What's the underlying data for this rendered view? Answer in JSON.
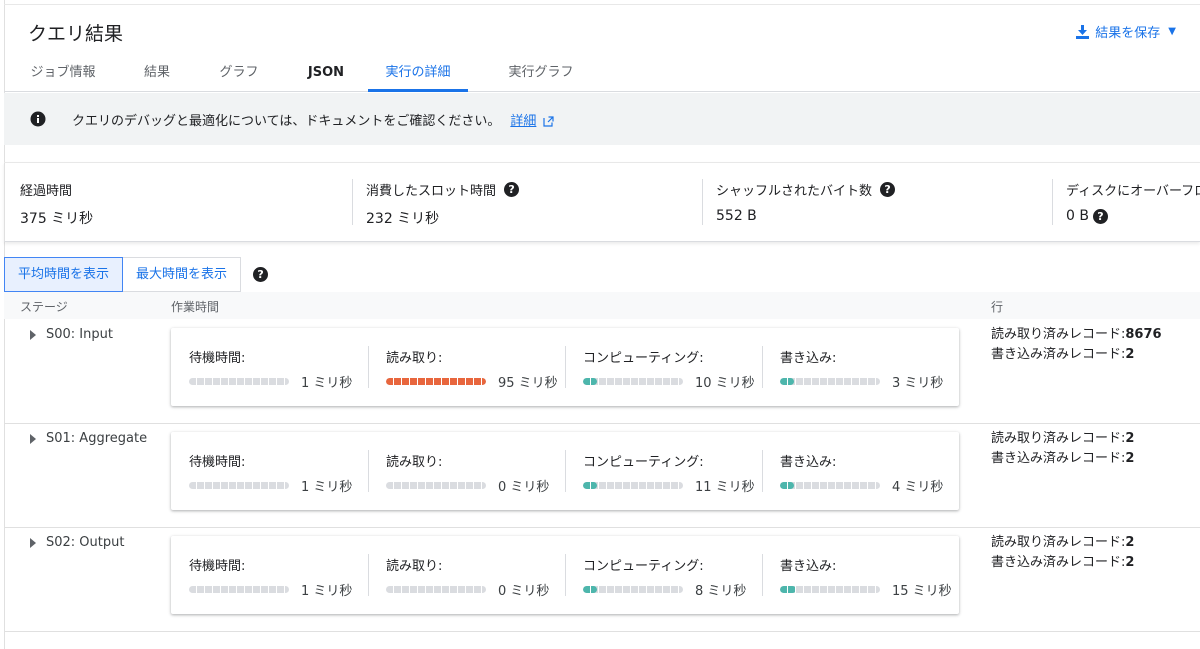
{
  "header": {
    "title": "クエリ結果",
    "save_label": "結果を保存"
  },
  "tabs": [
    {
      "label": "ジョブ情報"
    },
    {
      "label": "結果"
    },
    {
      "label": "グラフ"
    },
    {
      "label": "JSON"
    },
    {
      "label": "実行の詳細",
      "active": true
    },
    {
      "label": "実行グラフ"
    }
  ],
  "banner": {
    "text": "クエリのデバッグと最適化については、ドキュメントをご確認ください。",
    "link": "詳細"
  },
  "stats": [
    {
      "label": "経過時間",
      "value": "375 ミリ秒"
    },
    {
      "label": "消費したスロット時間",
      "value": "232 ミリ秒"
    },
    {
      "label": "シャッフルされたバイト数",
      "value": "552 B"
    },
    {
      "label": "ディスクにオーバーフロー",
      "value": "0 B"
    }
  ],
  "toggle": {
    "avg": "平均時間を表示",
    "max": "最大時間を表示"
  },
  "table_header": {
    "stage": "ステージ",
    "work": "作業時間",
    "rows": "行"
  },
  "segment_labels": {
    "wait": "待機時間:",
    "read": "読み取り:",
    "compute": "コンピューティング:",
    "write": "書き込み:"
  },
  "rows_labels": {
    "read": "読み取り済みレコード:",
    "written": "書き込み済みレコード:"
  },
  "colors": {
    "accent": "#1a73e8",
    "read_bar": "#e8663d",
    "compute_bar": "#4db6ac"
  },
  "stages": [
    {
      "name": "S00: Input",
      "wait": {
        "time": "1 ミリ秒",
        "fraction": 0.0
      },
      "read": {
        "time": "95 ミリ秒",
        "fraction": 1.0
      },
      "compute": {
        "time": "10 ミリ秒",
        "fraction": 0.1
      },
      "write": {
        "time": "3 ミリ秒",
        "fraction": 0.03
      },
      "records_read": "8676",
      "records_written": "2"
    },
    {
      "name": "S01: Aggregate",
      "wait": {
        "time": "1 ミリ秒",
        "fraction": 0.0
      },
      "read": {
        "time": "0 ミリ秒",
        "fraction": 0.0
      },
      "compute": {
        "time": "11 ミリ秒",
        "fraction": 0.12
      },
      "write": {
        "time": "4 ミリ秒",
        "fraction": 0.04
      },
      "records_read": "2",
      "records_written": "2"
    },
    {
      "name": "S02: Output",
      "wait": {
        "time": "1 ミリ秒",
        "fraction": 0.0
      },
      "read": {
        "time": "0 ミリ秒",
        "fraction": 0.0
      },
      "compute": {
        "time": "8 ミリ秒",
        "fraction": 0.08
      },
      "write": {
        "time": "15 ミリ秒",
        "fraction": 0.16
      },
      "records_read": "2",
      "records_written": "2"
    }
  ]
}
